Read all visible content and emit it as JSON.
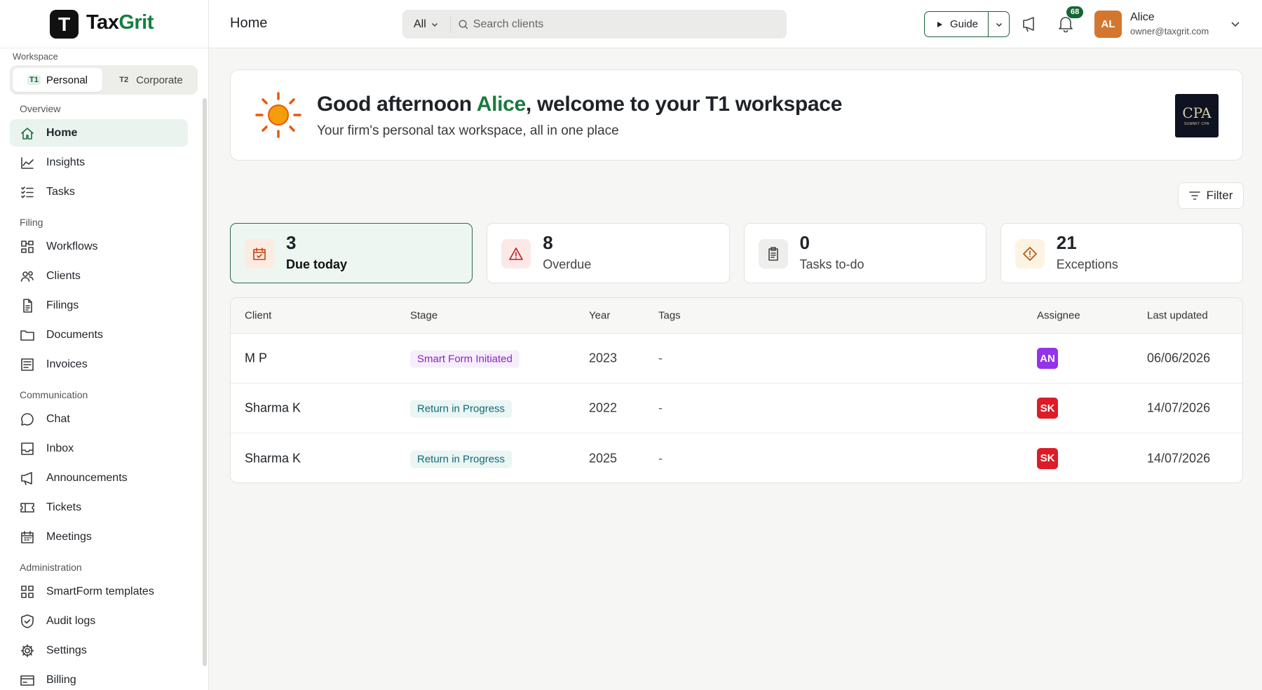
{
  "brand": {
    "mark": "T",
    "name_part1": "Tax",
    "name_part2": "Grit"
  },
  "workspace": {
    "label": "Workspace",
    "options": [
      {
        "code": "T1",
        "label": "Personal",
        "active": true
      },
      {
        "code": "T2",
        "label": "Corporate",
        "active": false
      }
    ]
  },
  "sidebar": {
    "sections": [
      {
        "label": "Overview",
        "items": [
          {
            "label": "Home",
            "icon": "home-icon",
            "active": true
          },
          {
            "label": "Insights",
            "icon": "chart-line-icon"
          },
          {
            "label": "Tasks",
            "icon": "checklist-icon"
          }
        ]
      },
      {
        "label": "Filing",
        "items": [
          {
            "label": "Workflows",
            "icon": "workflow-icon"
          },
          {
            "label": "Clients",
            "icon": "users-icon"
          },
          {
            "label": "Filings",
            "icon": "file-icon"
          },
          {
            "label": "Documents",
            "icon": "folder-icon"
          },
          {
            "label": "Invoices",
            "icon": "invoice-icon"
          }
        ]
      },
      {
        "label": "Communication",
        "items": [
          {
            "label": "Chat",
            "icon": "chat-icon"
          },
          {
            "label": "Inbox",
            "icon": "inbox-icon"
          },
          {
            "label": "Announcements",
            "icon": "megaphone-icon"
          },
          {
            "label": "Tickets",
            "icon": "ticket-icon"
          },
          {
            "label": "Meetings",
            "icon": "calendar-icon"
          }
        ]
      },
      {
        "label": "Administration",
        "items": [
          {
            "label": "SmartForm templates",
            "icon": "grid-icon"
          },
          {
            "label": "Audit logs",
            "icon": "shield-check-icon"
          },
          {
            "label": "Settings",
            "icon": "gear-icon"
          },
          {
            "label": "Billing",
            "icon": "billing-icon"
          }
        ]
      }
    ]
  },
  "topbar": {
    "title": "Home",
    "search": {
      "scope": "All",
      "placeholder": "Search clients"
    },
    "guide_label": "Guide",
    "notifications_count": "68",
    "user": {
      "initials": "AL",
      "name": "Alice",
      "email": "owner@taxgrit.com"
    }
  },
  "welcome": {
    "greeting_prefix": "Good afternoon ",
    "user_name": "Alice",
    "greeting_suffix": ", welcome to your T1 workspace",
    "subtitle": "Your firm's personal tax workspace, all in one place",
    "firm_logo_mono": "CPA",
    "firm_logo_text": "SUMMIT CPA"
  },
  "filter_label": "Filter",
  "stats": [
    {
      "value": "3",
      "label": "Due today",
      "icon": "calendar-check-icon",
      "active": true,
      "bg": "#fcebe0",
      "fg": "#c2410c"
    },
    {
      "value": "8",
      "label": "Overdue",
      "icon": "warning-icon",
      "active": false,
      "bg": "#fde8e8",
      "fg": "#b91c1c"
    },
    {
      "value": "0",
      "label": "Tasks to-do",
      "icon": "clipboard-icon",
      "active": false,
      "bg": "#eeeeec",
      "fg": "#444444"
    },
    {
      "value": "21",
      "label": "Exceptions",
      "icon": "diamond-alert-icon",
      "active": false,
      "bg": "#fdf3e3",
      "fg": "#b45309"
    }
  ],
  "table": {
    "columns": [
      "Client",
      "Stage",
      "Year",
      "Tags",
      "Assignee",
      "Last updated"
    ],
    "rows": [
      {
        "client": "M P",
        "stage": "Smart Form Initiated",
        "stage_style": "purple",
        "year": "2023",
        "tags": "-",
        "assignee": "AN",
        "assignee_color": "#9333ea",
        "updated": "06/06/2026"
      },
      {
        "client": "Sharma K",
        "stage": "Return in Progress",
        "stage_style": "teal",
        "year": "2022",
        "tags": "-",
        "assignee": "SK",
        "assignee_color": "#dc1c26",
        "updated": "14/07/2026"
      },
      {
        "client": "Sharma K",
        "stage": "Return in Progress",
        "stage_style": "teal",
        "year": "2025",
        "tags": "-",
        "assignee": "SK",
        "assignee_color": "#dc1c26",
        "updated": "14/07/2026"
      }
    ]
  }
}
